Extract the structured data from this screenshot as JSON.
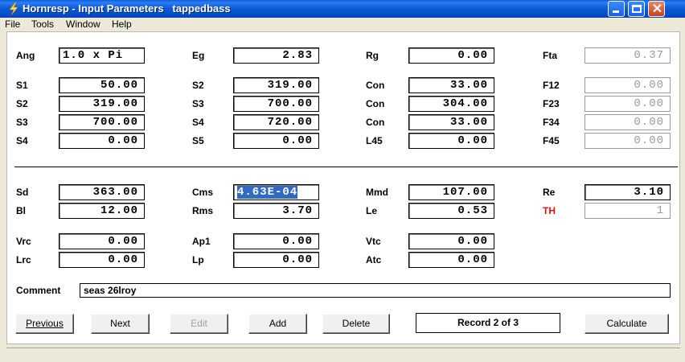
{
  "window": {
    "title": "Hornresp - Input Parameters   tappedbass"
  },
  "menu": [
    "File",
    "Tools",
    "Window",
    "Help"
  ],
  "labels": {
    "ang": "Ang",
    "eg": "Eg",
    "rg": "Rg",
    "fta": "Fta",
    "s1": "S1",
    "s2": "S2",
    "s3": "S3",
    "s4": "S4",
    "s5": "S5",
    "con": "Con",
    "l45": "L45",
    "f12": "F12",
    "f23": "F23",
    "f34": "F34",
    "f45": "F45",
    "sd": "Sd",
    "bl": "Bl",
    "cms": "Cms",
    "rms": "Rms",
    "mmd": "Mmd",
    "le": "Le",
    "re": "Re",
    "th": "TH",
    "vrc": "Vrc",
    "lrc": "Lrc",
    "ap1": "Ap1",
    "lp": "Lp",
    "vtc": "Vtc",
    "atc": "Atc",
    "comment": "Comment"
  },
  "values": {
    "ang": "1.0 x Pi",
    "eg": "2.83",
    "rg": "0.00",
    "fta": "0.37",
    "r1_s1": "50.00",
    "r1_s2": "319.00",
    "r1_con": "33.00",
    "f12": "0.00",
    "r2_s2": "319.00",
    "r2_s3": "700.00",
    "r2_con": "304.00",
    "f23": "0.00",
    "r3_s3": "700.00",
    "r3_s4": "720.00",
    "r3_con": "33.00",
    "f34": "0.00",
    "r4_s4": "0.00",
    "r4_s5": "0.00",
    "l45": "0.00",
    "f45": "0.00",
    "sd": "363.00",
    "cms": "4.63E-04",
    "mmd": "107.00",
    "re": "3.10",
    "bl": "12.00",
    "rms": "3.70",
    "le": "0.53",
    "th": "1",
    "vrc": "0.00",
    "ap1": "0.00",
    "vtc": "0.00",
    "lrc": "0.00",
    "lp": "0.00",
    "atc": "0.00",
    "comment": "seas 26lroy"
  },
  "buttons": {
    "previous": "Previous",
    "next": "Next",
    "edit": "Edit",
    "add": "Add",
    "delete": "Delete",
    "calculate": "Calculate"
  },
  "record": "Record 2 of 3",
  "colors": {
    "titlebar": "#0a58d8",
    "th_label": "#e01010",
    "selection": "#316ac5"
  }
}
